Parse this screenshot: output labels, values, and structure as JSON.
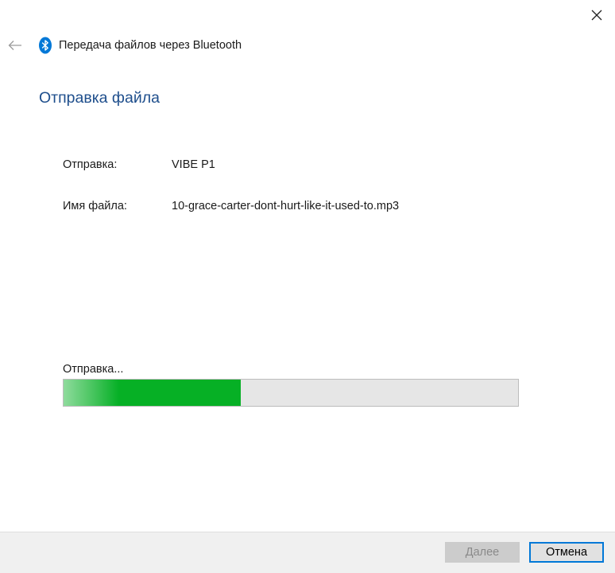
{
  "window": {
    "title": "Передача файлов через Bluetooth",
    "back_icon": "back-arrow-icon",
    "close_icon": "close-icon",
    "app_icon": "bluetooth-icon",
    "accent_color": "#0078d7"
  },
  "main": {
    "heading": "Отправка файла",
    "sending_to_label": "Отправка:",
    "sending_to_value": "VIBE P1",
    "file_name_label": "Имя файла:",
    "file_name_value": "10-grace-carter-dont-hurt-like-it-used-to.mp3",
    "status_text": "Отправка...",
    "progress_fraction": 0.39,
    "progress_color": "#06b025"
  },
  "footer": {
    "next_label": "Далее",
    "cancel_label": "Отмена"
  }
}
